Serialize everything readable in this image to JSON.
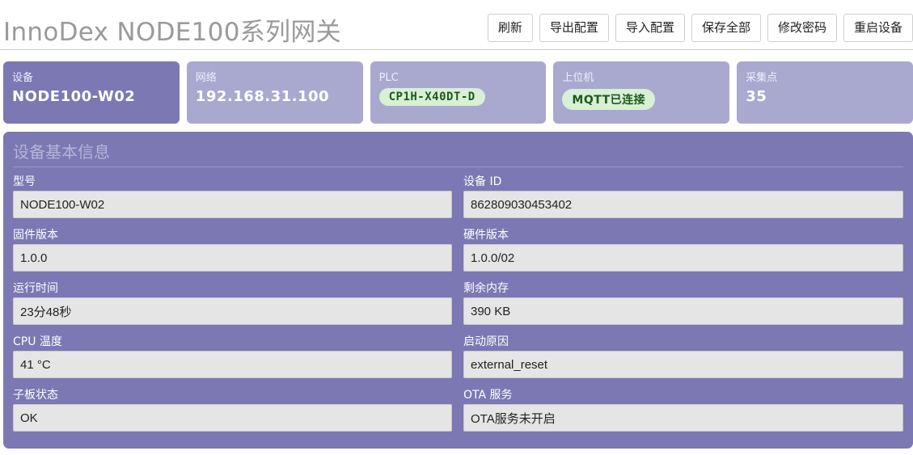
{
  "header": {
    "title": "InnoDex NODE100系列网关",
    "buttons": [
      "刷新",
      "导出配置",
      "导入配置",
      "保存全部",
      "修改密码",
      "重启设备"
    ]
  },
  "cards": [
    {
      "label": "设备",
      "value": "NODE100-W02"
    },
    {
      "label": "网络",
      "value": "192.168.31.100"
    },
    {
      "label": "PLC",
      "value": "CP1H-X40DT-D"
    },
    {
      "label": "上位机",
      "value": "MQTT已连接"
    },
    {
      "label": "采集点",
      "value": "35"
    }
  ],
  "panel": {
    "title": "设备基本信息",
    "fields": [
      {
        "label": "型号",
        "value": "NODE100-W02"
      },
      {
        "label": "设备 ID",
        "value": "862809030453402"
      },
      {
        "label": "固件版本",
        "value": "1.0.0"
      },
      {
        "label": "硬件版本",
        "value": "1.0.0/02"
      },
      {
        "label": "运行时间",
        "value": "23分48秒"
      },
      {
        "label": "剩余内存",
        "value": "390 KB"
      },
      {
        "label": "CPU 温度",
        "value": "41 °C"
      },
      {
        "label": "启动原因",
        "value": "external_reset"
      },
      {
        "label": "子板状态",
        "value": "OK"
      },
      {
        "label": "OTA 服务",
        "value": "OTA服务未开启"
      }
    ]
  },
  "colors": {
    "accent": "#7b78b4",
    "card_inactive": "#a9a9cf",
    "status_ok_bg": "#d7f0d6",
    "status_ok_text": "#1e5a1e"
  }
}
